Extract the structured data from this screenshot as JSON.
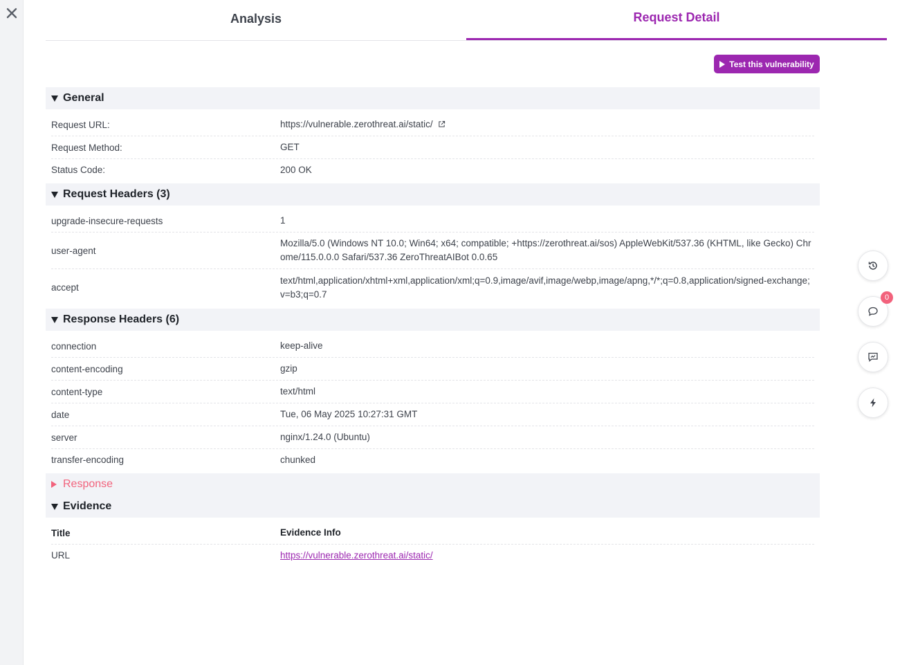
{
  "tabs": [
    {
      "label": "Analysis",
      "active": false
    },
    {
      "label": "Request Detail",
      "active": true
    }
  ],
  "actions": {
    "test_label": "Test this vulnerability"
  },
  "general": {
    "title": "General",
    "rows": [
      {
        "key": "Request URL:",
        "value": "https://vulnerable.zerothreat.ai/static/"
      },
      {
        "key": "Request Method:",
        "value": "GET"
      },
      {
        "key": "Status Code:",
        "value": "200 OK"
      }
    ]
  },
  "request_headers": {
    "title": "Request Headers (3)",
    "rows": [
      {
        "key": "upgrade-insecure-requests",
        "value": "1"
      },
      {
        "key": "user-agent",
        "value": "Mozilla/5.0 (Windows NT 10.0; Win64; x64; compatible; +https://zerothreat.ai/sos) AppleWebKit/537.36 (KHTML, like Gecko) Chrome/115.0.0.0 Safari/537.36 ZeroThreatAIBot 0.0.65"
      },
      {
        "key": "accept",
        "value": "text/html,application/xhtml+xml,application/xml;q=0.9,image/avif,image/webp,image/apng,*/*;q=0.8,application/signed-exchange;v=b3;q=0.7"
      }
    ]
  },
  "response_headers": {
    "title": "Response Headers (6)",
    "rows": [
      {
        "key": "connection",
        "value": "keep-alive"
      },
      {
        "key": "content-encoding",
        "value": "gzip"
      },
      {
        "key": "content-type",
        "value": "text/html"
      },
      {
        "key": "date",
        "value": "Tue, 06 May 2025 10:27:31 GMT"
      },
      {
        "key": "server",
        "value": "nginx/1.24.0 (Ubuntu)"
      },
      {
        "key": "transfer-encoding",
        "value": "chunked"
      }
    ]
  },
  "response": {
    "title": "Response"
  },
  "evidence": {
    "title": "Evidence",
    "col_title": "Title",
    "col_info": "Evidence Info",
    "rows": [
      {
        "key": "URL",
        "value": "https://vulnerable.zerothreat.ai/static/"
      }
    ]
  },
  "side": {
    "comments_count": "0"
  },
  "icons": {
    "close": "close-icon",
    "history": "history-icon",
    "comment": "comment-icon",
    "chat": "chat-icon",
    "bolt": "bolt-icon",
    "external": "external-link-icon",
    "play": "play-icon"
  },
  "colors": {
    "accent": "#9c27b0",
    "badge": "#f2627c",
    "section_bg": "#f2f3f7"
  }
}
